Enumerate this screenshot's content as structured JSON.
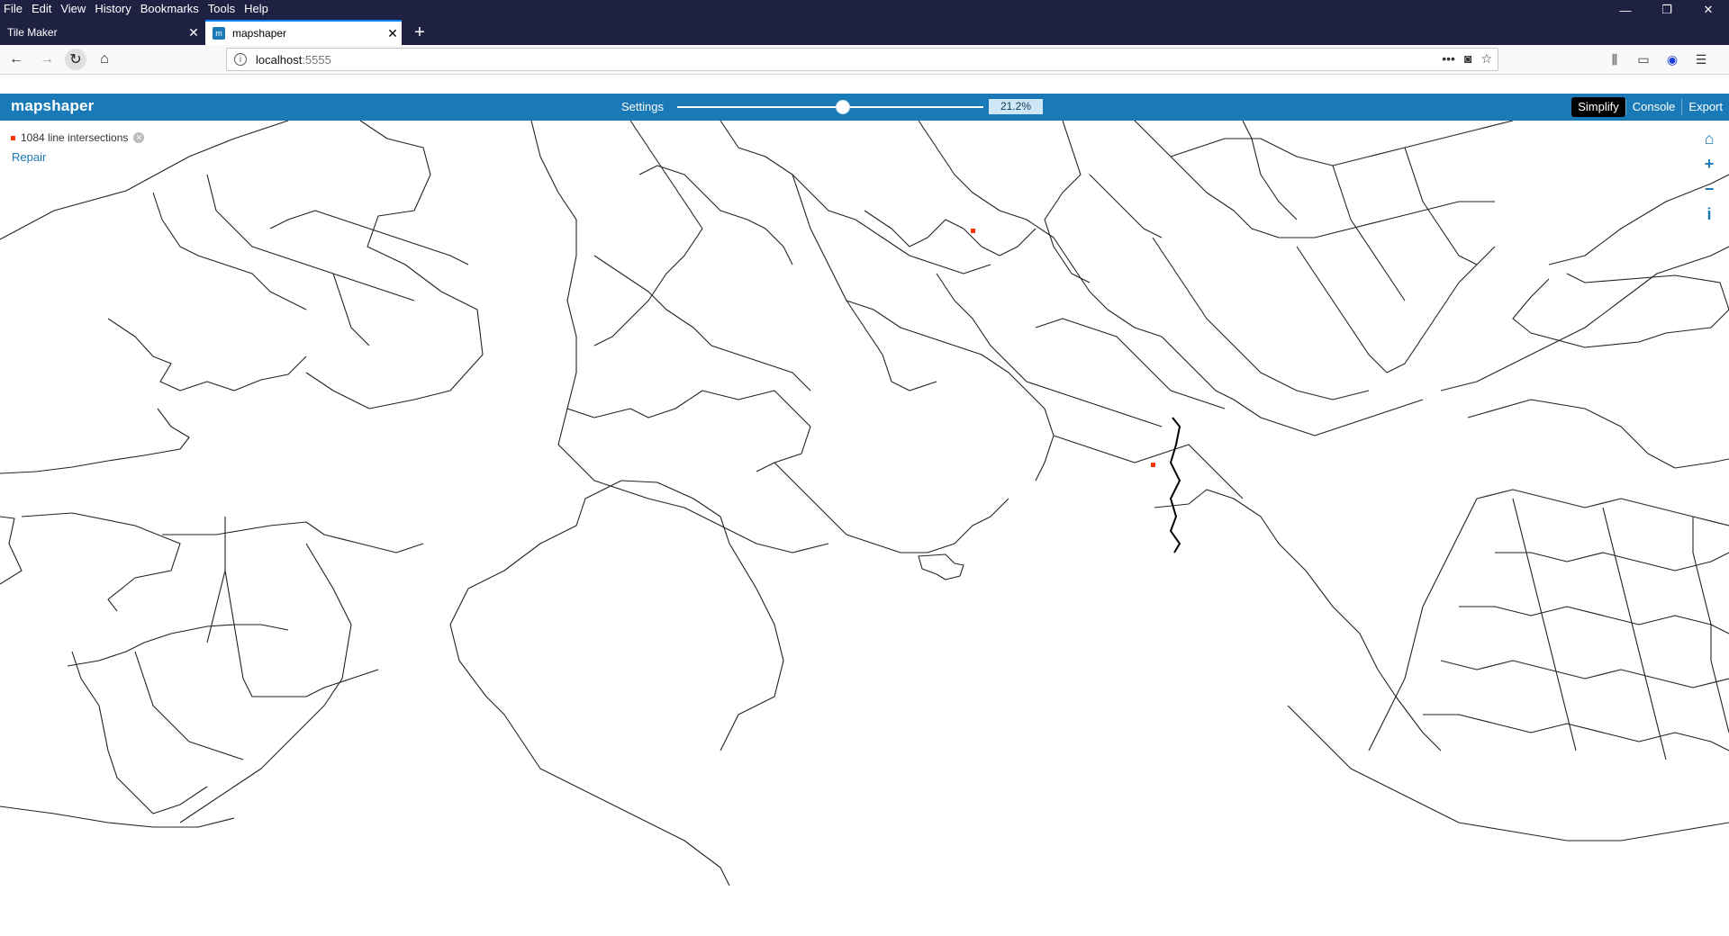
{
  "browser": {
    "menus": [
      "File",
      "Edit",
      "View",
      "History",
      "Bookmarks",
      "Tools",
      "Help"
    ],
    "window_controls": {
      "minimize": "—",
      "restore": "❐",
      "close": "✕"
    },
    "tabs": [
      {
        "title": "Tile Maker",
        "active": false
      },
      {
        "title": "mapshaper",
        "active": true
      }
    ],
    "new_tab": "+",
    "url": {
      "host": "localhost",
      "port": ":5555"
    },
    "url_actions": [
      "•••",
      "pocket-icon",
      "star-icon"
    ]
  },
  "app": {
    "logo": "mapshaper",
    "settings_label": "Settings",
    "simplify_percent": "21.2%",
    "slider_fraction": 0.54,
    "buttons": {
      "simplify": "Simplify",
      "console": "Console",
      "export": "Export"
    },
    "accent_color": "#1a7ab8"
  },
  "map": {
    "intersections_label": "1084 line intersections",
    "repair_label": "Repair",
    "intersection_color": "#ff3300",
    "tools": [
      "home-icon",
      "zoom-in-icon",
      "zoom-out-icon",
      "info-icon"
    ]
  }
}
